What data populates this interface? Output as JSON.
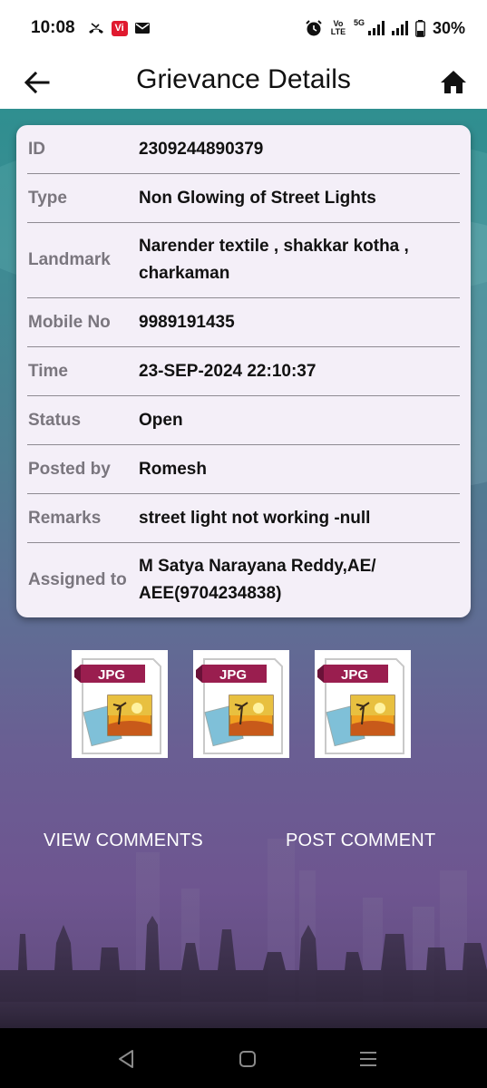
{
  "status_bar": {
    "time": "10:08",
    "battery": "30%",
    "icons": [
      "missed-call-icon",
      "vi-app-icon",
      "gmail-icon",
      "alarm-icon",
      "volte-icon",
      "5g-signal-icon",
      "signal-icon",
      "battery-icon"
    ],
    "volte_label": "Vo LTE",
    "network_label": "5G",
    "vi_label": "Vi"
  },
  "app_bar": {
    "title": "Grievance Details",
    "back_icon": "arrow-left-icon",
    "home_icon": "home-icon"
  },
  "details": [
    {
      "label": "ID",
      "value": "2309244890379"
    },
    {
      "label": "Type",
      "value": "Non Glowing of Street Lights"
    },
    {
      "label": "Landmark",
      "value": "Narender textile , shakkar kotha , charkaman"
    },
    {
      "label": "Mobile No",
      "value": "9989191435"
    },
    {
      "label": "Time",
      "value": "23-SEP-2024 22:10:37"
    },
    {
      "label": "Status",
      "value": "Open"
    },
    {
      "label": "Posted by",
      "value": "Romesh"
    },
    {
      "label": "Remarks",
      "value": "street light not working -null"
    },
    {
      "label": "Assigned to",
      "value": "M Satya Narayana Reddy,AE/ AEE(9704234838)"
    }
  ],
  "attachments": [
    {
      "badge": "JPG"
    },
    {
      "badge": "JPG"
    },
    {
      "badge": "JPG"
    }
  ],
  "actions": {
    "view_comments": "VIEW COMMENTS",
    "post_comment": "POST COMMENT"
  },
  "nav_bar": {
    "icons": [
      "back-triangle-icon",
      "home-square-icon",
      "recents-menu-icon"
    ]
  },
  "colors": {
    "card_bg": "#f4eff8",
    "label": "#7a767e",
    "value": "#111111",
    "jpg_badge": "#9a1e4f",
    "bg_top": "#2f8f90",
    "bg_bottom": "#6e5590"
  }
}
